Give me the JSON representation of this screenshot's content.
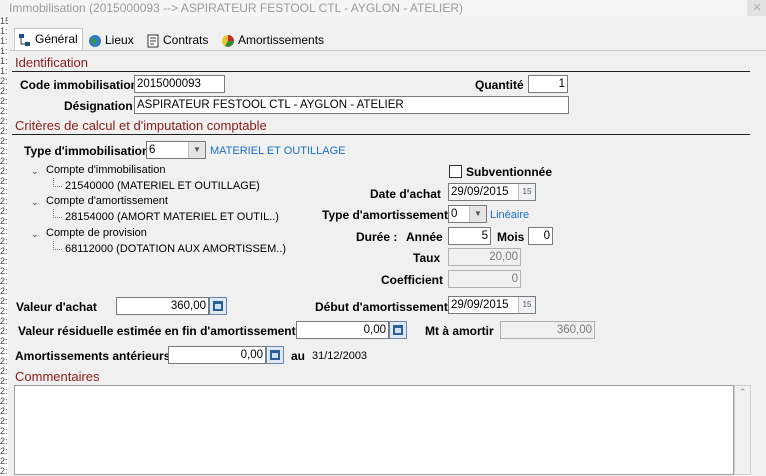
{
  "window": {
    "title": "Immobilisation (2015000093 --> ASPIRATEUR FESTOOL CTL - AYGLON - ATELIER)"
  },
  "left_strip": [
    "15",
    "1:",
    "1:",
    "1:",
    "1:",
    "1:",
    "2:",
    "2:",
    "2:",
    "2:",
    "2:",
    "2:",
    "2:",
    "2:",
    "2:",
    "2:",
    "2:",
    "2:",
    "2:",
    "2:",
    "2:",
    "2:",
    "2:",
    "2:",
    "2:",
    "2:",
    "2:",
    "2:",
    "2:",
    "2:",
    "2:",
    "2:",
    "2:",
    "2:",
    "2:",
    "2:",
    "2:",
    "2:",
    "2:",
    "2:",
    "2:",
    "2:",
    "2:",
    "2:",
    "2:",
    "2:"
  ],
  "tabs": [
    {
      "label": "Général",
      "icon": "tree-icon",
      "active": true
    },
    {
      "label": "Lieux",
      "icon": "globe-icon",
      "active": false
    },
    {
      "label": "Contrats",
      "icon": "contract-icon",
      "active": false
    },
    {
      "label": "Amortissements",
      "icon": "depreciation-icon",
      "active": false
    }
  ],
  "identification": {
    "section_title": "Identification",
    "code_label": "Code immobilisation",
    "code_value": "2015000093",
    "quantity_label": "Quantité",
    "quantity_value": "1",
    "designation_label": "Désignation",
    "designation_value": "ASPIRATEUR FESTOOL CTL - AYGLON - ATELIER"
  },
  "criteria": {
    "section_title": "Critères de calcul et d'imputation comptable",
    "type_label": "Type d'immobilisation",
    "type_value": "6",
    "type_desc": "MATERIEL ET OUTILLAGE",
    "tree": [
      {
        "label": "Compte d'immobilisation",
        "child": "21540000 (MATERIEL ET OUTILLAGE)"
      },
      {
        "label": "Compte d'amortissement",
        "child": "28154000 (AMORT MATERIEL ET OUTIL..)"
      },
      {
        "label": "Compte de provision",
        "child": "68112000 (DOTATION AUX AMORTISSEM..)"
      }
    ],
    "subventionnee_label": "Subventionnée",
    "date_achat_label": "Date d'achat",
    "date_achat_value": "29/09/2015",
    "type_amort_label": "Type d'amortissement",
    "type_amort_value": "0",
    "type_amort_desc": "Linéaire",
    "duree_label": "Durée :",
    "annee_label": "Année",
    "annee_value": "5",
    "mois_label": "Mois",
    "mois_value": "0",
    "taux_label": "Taux",
    "taux_value": "20,00",
    "coef_label": "Coefficient",
    "coef_value": "0",
    "valeur_achat_label": "Valeur d'achat",
    "valeur_achat_value": "360,00",
    "debut_amort_label": "Début d'amortissement",
    "debut_amort_value": "29/09/2015",
    "valeur_resid_label": "Valeur résiduelle estimée en fin d'amortissement",
    "valeur_resid_value": "0,00",
    "mt_amortir_label": "Mt à amortir",
    "mt_amortir_value": "360,00",
    "amort_ant_label": "Amortissements antérieurs",
    "amort_ant_value": "0,00",
    "au_label": "au",
    "au_date": "31/12/2003"
  },
  "commentaires": {
    "section_title": "Commentaires",
    "value": ""
  },
  "colors": {
    "section_title": "#8b1a1a",
    "link_blue": "#1a6fc4"
  }
}
